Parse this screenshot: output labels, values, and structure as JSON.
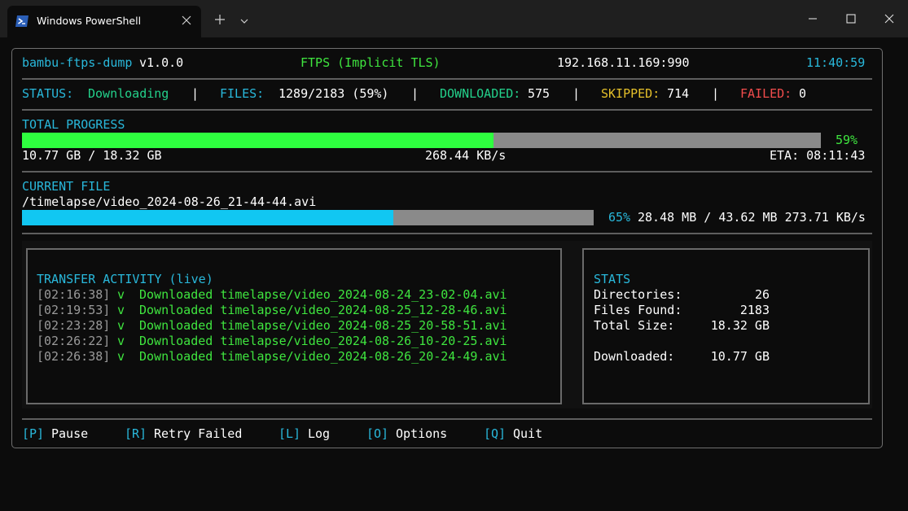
{
  "window": {
    "tab_title": "Windows PowerShell",
    "icons": [
      "powershell-icon",
      "close-icon",
      "plus-icon",
      "chevron-down-icon",
      "minimize-icon",
      "maximize-icon",
      "window-close-icon"
    ]
  },
  "header": {
    "app_name": "bambu-ftps-dump",
    "version": "v1.0.0",
    "protocol": "FTPS (Implicit TLS)",
    "host": "192.168.11.169:990",
    "time": "11:40:59"
  },
  "status_line": {
    "status_label": "STATUS:",
    "status_value": "Downloading",
    "sep": "|",
    "files_label": "FILES:",
    "files_value": "1289/2183 (59%)",
    "downloaded_label": "DOWNLOADED:",
    "downloaded_value": "575",
    "skipped_label": "SKIPPED:",
    "skipped_value": "714",
    "failed_label": "FAILED:",
    "failed_value": "0"
  },
  "total_progress": {
    "label": "TOTAL PROGRESS",
    "fraction": 0.59,
    "percent_text": "59%",
    "size_text": "10.77 GB / 18.32 GB",
    "speed_text": "268.44 KB/s",
    "eta_text": "ETA: 08:11:43"
  },
  "current_file": {
    "label": "CURRENT FILE",
    "path": "/timelapse/video_2024-08-26_21-44-44.avi",
    "fraction": 0.65,
    "percent_text": "65%",
    "detail_text": "28.48 MB / 43.62 MB 273.71 KB/s"
  },
  "activity": {
    "title": "TRANSFER ACTIVITY (live)",
    "entries": [
      {
        "time": "[02:16:38]",
        "mark": "v",
        "text": "Downloaded timelapse/video_2024-08-24_23-02-04.avi"
      },
      {
        "time": "[02:19:53]",
        "mark": "v",
        "text": "Downloaded timelapse/video_2024-08-25_12-28-46.avi"
      },
      {
        "time": "[02:23:28]",
        "mark": "v",
        "text": "Downloaded timelapse/video_2024-08-25_20-58-51.avi"
      },
      {
        "time": "[02:26:22]",
        "mark": "v",
        "text": "Downloaded timelapse/video_2024-08-26_10-20-25.avi"
      },
      {
        "time": "[02:26:38]",
        "mark": "v",
        "text": "Downloaded timelapse/video_2024-08-26_20-24-49.avi"
      }
    ]
  },
  "stats": {
    "title": "STATS",
    "rows": [
      {
        "label": "Directories:",
        "value": "26"
      },
      {
        "label": "Files Found:",
        "value": "2183"
      },
      {
        "label": "Total Size:",
        "value": "18.32 GB"
      },
      {
        "label": "Downloaded:",
        "value": "10.77 GB"
      }
    ]
  },
  "footer": {
    "keys": [
      {
        "key": "[P]",
        "label": "Pause"
      },
      {
        "key": "[R]",
        "label": "Retry Failed"
      },
      {
        "key": "[L]",
        "label": "Log"
      },
      {
        "key": "[O]",
        "label": "Options"
      },
      {
        "key": "[Q]",
        "label": "Quit"
      }
    ]
  },
  "colors": {
    "cyan": "#29b8db",
    "green": "#23d18b",
    "bright_green": "#3fe53f",
    "yellow": "#e5c02a",
    "red": "#f14c4c",
    "bar_bg": "#8a8a8a"
  }
}
